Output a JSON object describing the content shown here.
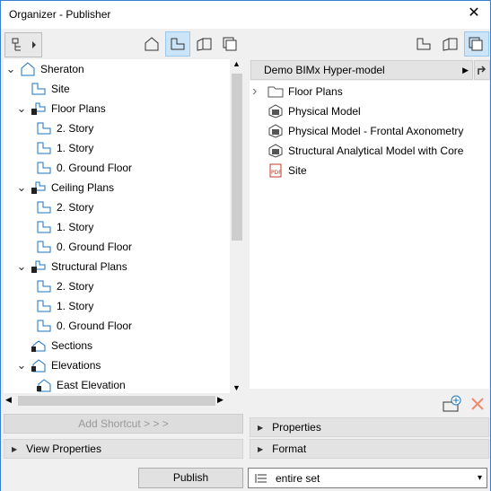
{
  "window": {
    "title": "Organizer - Publisher",
    "close": "✕"
  },
  "left": {
    "tree": [
      {
        "label": "Sheraton",
        "level": 0,
        "expanded": true,
        "icon": "project-icon"
      },
      {
        "label": "Site",
        "level": 1,
        "icon": "story-icon"
      },
      {
        "label": "Floor Plans",
        "level": 1,
        "expanded": true,
        "icon": "folder-view-icon"
      },
      {
        "label": "2. Story",
        "level": 2,
        "icon": "story-icon"
      },
      {
        "label": "1. Story",
        "level": 2,
        "icon": "story-icon"
      },
      {
        "label": "0. Ground Floor",
        "level": 2,
        "icon": "story-icon"
      },
      {
        "label": "Ceiling Plans",
        "level": 1,
        "expanded": true,
        "icon": "folder-view-icon"
      },
      {
        "label": "2. Story",
        "level": 2,
        "icon": "story-icon"
      },
      {
        "label": "1. Story",
        "level": 2,
        "icon": "story-icon"
      },
      {
        "label": "0. Ground Floor",
        "level": 2,
        "icon": "story-icon"
      },
      {
        "label": "Structural Plans",
        "level": 1,
        "expanded": true,
        "icon": "folder-view-icon"
      },
      {
        "label": "2. Story",
        "level": 2,
        "icon": "story-icon"
      },
      {
        "label": "1. Story",
        "level": 2,
        "icon": "story-icon"
      },
      {
        "label": "0. Ground Floor",
        "level": 2,
        "icon": "story-icon"
      },
      {
        "label": "Sections",
        "level": 1,
        "icon": "section-icon"
      },
      {
        "label": "Elevations",
        "level": 1,
        "expanded": true,
        "icon": "elevation-icon"
      },
      {
        "label": "East Elevation",
        "level": 2,
        "icon": "elevation-icon"
      }
    ],
    "add_shortcut": "Add Shortcut > > >",
    "view_properties": "View Properties"
  },
  "right": {
    "header": "Demo BIMx Hyper-model",
    "items": [
      {
        "label": "Floor Plans",
        "icon": "folder-icon",
        "chevron": true
      },
      {
        "label": "Physical Model",
        "icon": "bimx-icon"
      },
      {
        "label": "Physical Model - Frontal Axonometry",
        "icon": "bimx-icon"
      },
      {
        "label": "Structural Analytical Model with Core",
        "icon": "bimx-icon"
      },
      {
        "label": "Site",
        "icon": "pdf-icon"
      }
    ],
    "properties": "Properties",
    "format": "Format"
  },
  "bottom": {
    "publish": "Publish",
    "set": "entire set"
  },
  "colors": {
    "accent": "#3a7fd0",
    "selected_tab": "#cce4f7",
    "icon_blue": "#1e73be"
  }
}
